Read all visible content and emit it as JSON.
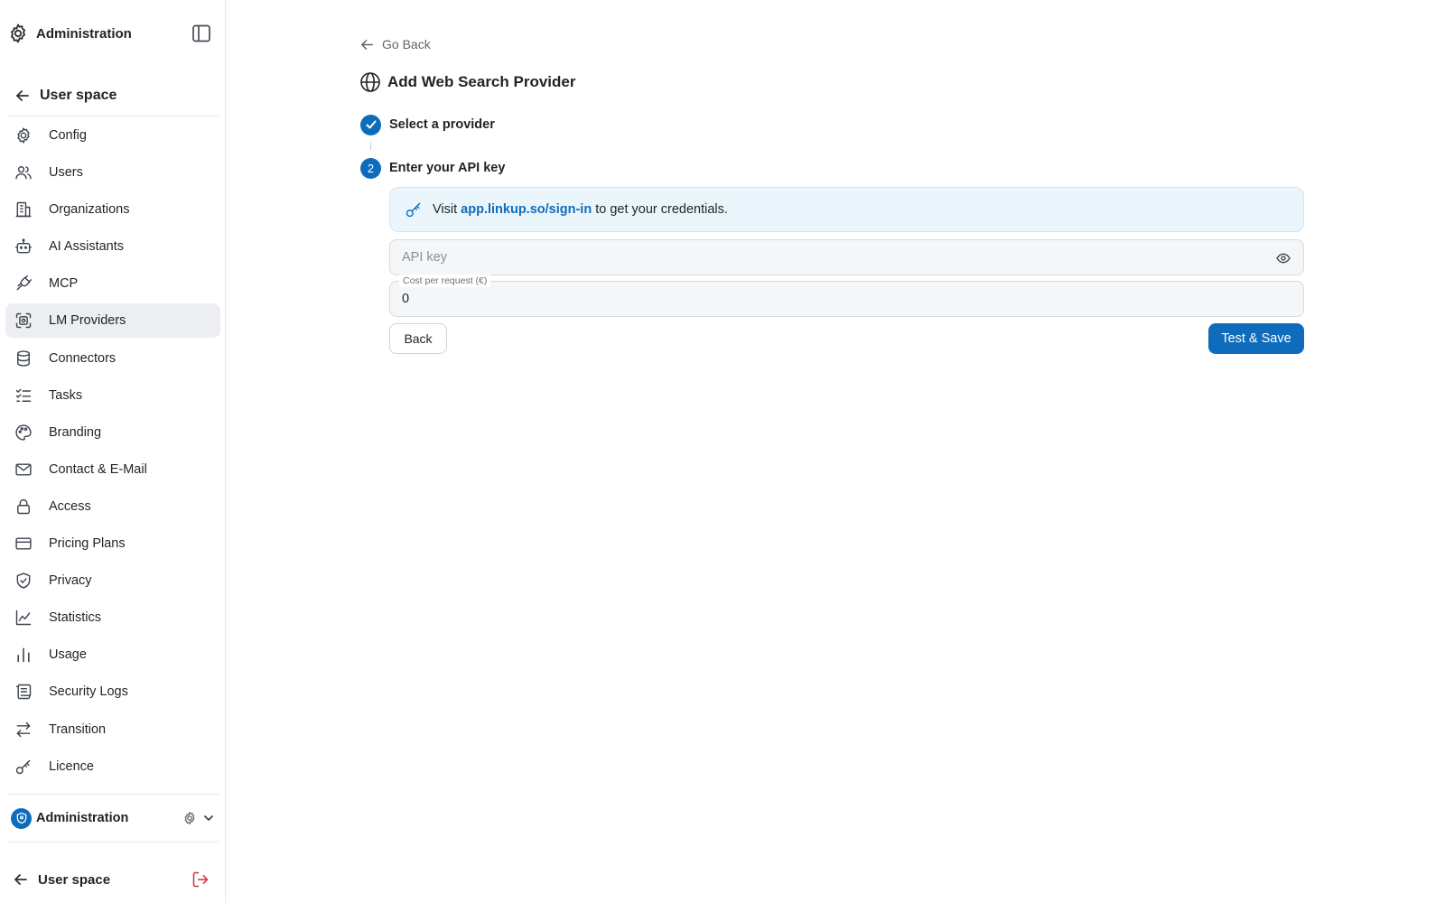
{
  "sidebar": {
    "app_title": "Administration",
    "back_label": "User space",
    "items": [
      {
        "label": "Config"
      },
      {
        "label": "Users"
      },
      {
        "label": "Organizations"
      },
      {
        "label": "AI Assistants"
      },
      {
        "label": "MCP"
      },
      {
        "label": "LM Providers"
      },
      {
        "label": "Connectors"
      },
      {
        "label": "Tasks"
      },
      {
        "label": "Branding"
      },
      {
        "label": "Contact & E-Mail"
      },
      {
        "label": "Access"
      },
      {
        "label": "Pricing Plans"
      },
      {
        "label": "Privacy"
      },
      {
        "label": "Statistics"
      },
      {
        "label": "Usage"
      },
      {
        "label": "Security Logs"
      },
      {
        "label": "Transition"
      },
      {
        "label": "Licence"
      }
    ],
    "active_item": "LM Providers",
    "org_label": "Administration",
    "user_space_label": "User space"
  },
  "main": {
    "go_back": "Go Back",
    "title": "Add Web Search Provider",
    "steps": [
      {
        "number": "1",
        "label": "Select a provider",
        "status": "completed"
      },
      {
        "number": "2",
        "label": "Enter your API key",
        "status": "current"
      }
    ],
    "info": {
      "prefix": "Visit",
      "link": "app.linkup.so/sign-in",
      "suffix": "to get your credentials."
    },
    "api_key": {
      "placeholder": "API key",
      "value": ""
    },
    "cost": {
      "label": "Cost per request (€)",
      "value": "0"
    },
    "back_button": "Back",
    "save_button": "Test & Save"
  },
  "colors": {
    "accent": "#0f6cbd",
    "info_background": "#ebf5fc",
    "active_nav_background": "#eceef1",
    "logout_icon": "#d13438"
  }
}
